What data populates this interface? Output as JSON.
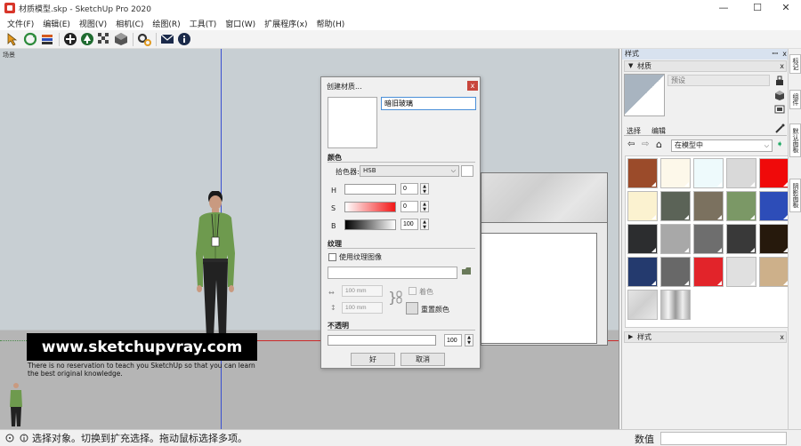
{
  "window": {
    "title": "材质模型.skp - SketchUp Pro 2020",
    "minimize": "—",
    "maximize": "☐",
    "close": "✕"
  },
  "menu": [
    "文件(F)",
    "编辑(E)",
    "视图(V)",
    "相机(C)",
    "绘图(R)",
    "工具(T)",
    "窗口(W)",
    "扩展程序(x)",
    "帮助(H)"
  ],
  "viewport": {
    "scene_label": "场景"
  },
  "watermark": {
    "title": "www.sketchupvray.com",
    "line1": "There is no reservation to teach you SketchUp so that you can learn",
    "line2": "the best original knowledge."
  },
  "dialog": {
    "title": "创建材质...",
    "close": "x",
    "name_value": "暗旧玻璃",
    "color_section": "颜色",
    "picker_label": "拾色器:",
    "picker_value": "HSB",
    "h_label": "H",
    "h_value": "0",
    "s_label": "S",
    "s_value": "0",
    "b_label": "B",
    "b_value": "100",
    "texture_section": "纹理",
    "use_texture_label": "使用纹理图像",
    "width_value": "100 mm",
    "height_value": "100 mm",
    "tint_label": "着色",
    "reset_label": "重置颜色",
    "opacity_section": "不透明",
    "opacity_value": "100",
    "ok_label": "好",
    "cancel_label": "取消"
  },
  "tray": {
    "title": "样式",
    "pin": "ꟷ",
    "close": "x",
    "materials_header": "材质",
    "material_name_placeholder": "预设",
    "tab_select": "选择",
    "tab_edit": "编辑",
    "library": "在模型中",
    "styles_header": "样式",
    "swatches": [
      "#9b4b2a",
      "#fdf8ea",
      "#eefafc",
      "#d9d9d9",
      "#f00a0a",
      "#fbf2d0",
      "#5b6357",
      "#7b715f",
      "#7b9866",
      "#2d4db8",
      "#2c2d2f",
      "#a8a8a8",
      "#6e6e6e",
      "#393939",
      "#26190c",
      "#243a6e",
      "#686868",
      "#e2242a",
      "#e0e0e0",
      "#cdb08a"
    ]
  },
  "side_tabs": [
    "标记",
    "组件",
    "默认面板",
    "阴影面板"
  ],
  "status": {
    "text": "选择对象。切换到扩充选择。拖动鼠标选择多项。",
    "value_label": "数值",
    "value": ""
  }
}
